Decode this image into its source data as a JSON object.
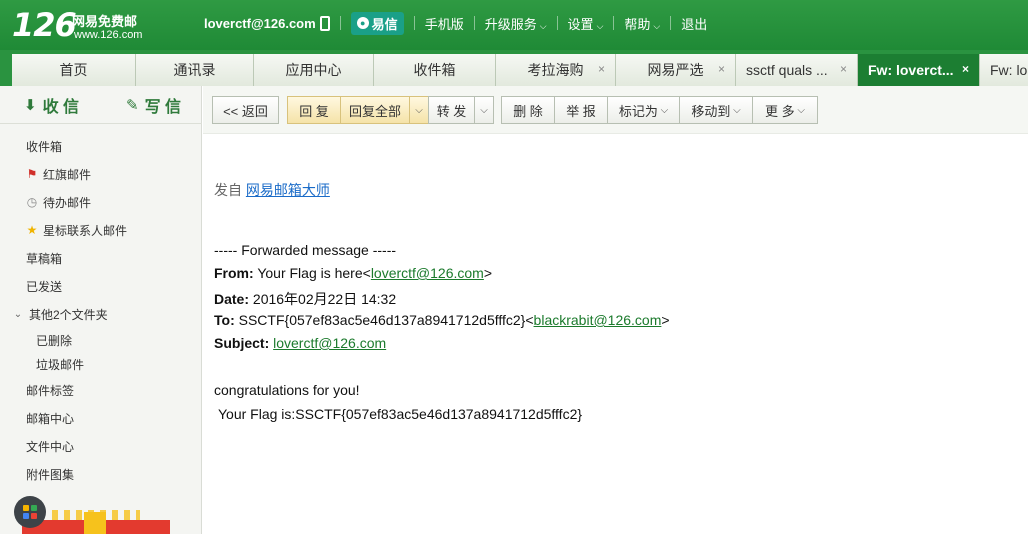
{
  "header": {
    "logo_number": "126",
    "logo_name": "网易免费邮",
    "logo_url": "www.126.com",
    "user": "loverctf@126.com",
    "yixin": "易信",
    "mobile": "手机版",
    "upgrade": "升级服务",
    "settings": "设置",
    "help": "帮助",
    "logout": "退出"
  },
  "tabs": [
    {
      "label": "首页"
    },
    {
      "label": "通讯录"
    },
    {
      "label": "应用中心"
    },
    {
      "label": "收件箱"
    },
    {
      "label": "考拉海购",
      "close": "×"
    },
    {
      "label": "网易严选",
      "close": "×"
    },
    {
      "label": "ssctf quals ...",
      "close": "×"
    },
    {
      "label": "Fw: loverct...",
      "close": "×"
    },
    {
      "label": "Fw: lo"
    }
  ],
  "sidebar": {
    "receive": "收 信",
    "write": "写 信",
    "folders": [
      {
        "label": "收件箱"
      },
      {
        "label": "红旗邮件"
      },
      {
        "label": "待办邮件"
      },
      {
        "label": "星标联系人邮件"
      },
      {
        "label": "草稿箱"
      },
      {
        "label": "已发送"
      },
      {
        "label": "其他2个文件夹"
      },
      {
        "label": "已删除"
      },
      {
        "label": "垃圾邮件"
      },
      {
        "label": "邮件标签"
      },
      {
        "label": "邮箱中心"
      },
      {
        "label": "文件中心"
      },
      {
        "label": "附件图集"
      }
    ]
  },
  "toolbar": {
    "back": "<< 返回",
    "reply": "回 复",
    "reply_all": "回复全部",
    "forward": "转 发",
    "delete": "删 除",
    "report": "举 报",
    "mark_as": "标记为",
    "move_to": "移动到",
    "more": "更 多"
  },
  "message": {
    "from_prefix": "发自",
    "from_app": "网易邮箱大师",
    "forward_header": "----- Forwarded message -----",
    "from_label": "From:",
    "from_name": "Your Flag is here<",
    "from_email": "loverctf@126.com",
    "from_close": ">",
    "date_label": "Date:",
    "date_value": "2016年02月22日 14:32",
    "to_label": "To:",
    "to_name": "SSCTF{057ef83ac5e46d137a8941712d5fffc2}<",
    "to_email": "blackrabit@126.com",
    "to_close": ">",
    "subject_label": "Subject:",
    "subject_value": "loverctf@126.com",
    "body1": "congratulations for you!",
    "body2": "Your Flag is:SSCTF{057ef83ac5e46d137a8941712d5fffc2}"
  },
  "colors": {
    "header_green": "#2f9a43",
    "active_tab": "#1c7e32",
    "link_blue": "#1a6bc8",
    "link_green": "#1b7a2c",
    "highlight_button": "#f5e3a8"
  }
}
